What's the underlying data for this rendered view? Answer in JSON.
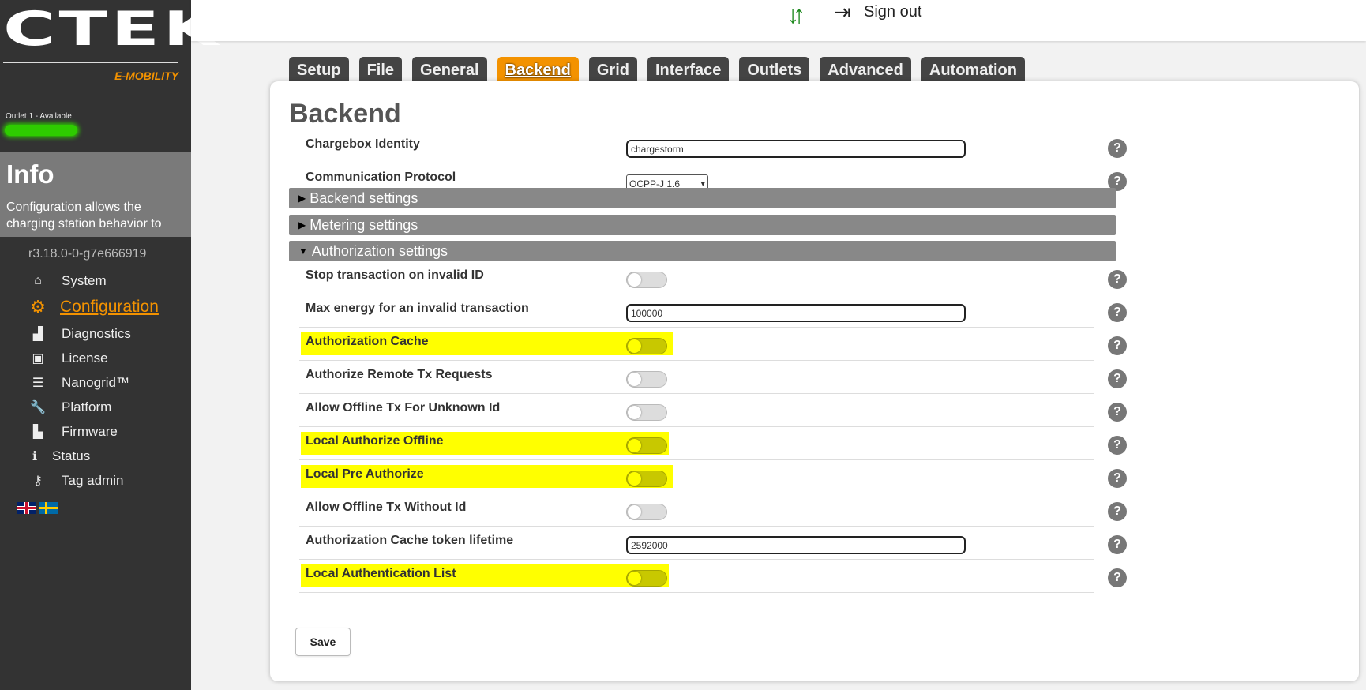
{
  "brand": {
    "logo": "CTEK",
    "sub": "E-MOBILITY"
  },
  "outlet": {
    "label": "Outlet 1 - Available",
    "led_color": "#2ecc00"
  },
  "info": {
    "title": "Info",
    "text": "Configuration allows the charging station behavior to"
  },
  "version": "r3.18.0-0-g7e666919",
  "nav": [
    {
      "label": "System",
      "icon": "home-icon",
      "glyph": "⌂"
    },
    {
      "label": "Configuration",
      "icon": "gear-icon",
      "glyph": "⚙",
      "active": true
    },
    {
      "label": "Diagnostics",
      "icon": "bar-chart-icon",
      "glyph": "▟"
    },
    {
      "label": "License",
      "icon": "license-icon",
      "glyph": "▣"
    },
    {
      "label": "Nanogrid™",
      "icon": "sliders-icon",
      "glyph": "☰"
    },
    {
      "label": "Platform",
      "icon": "wrench-icon",
      "glyph": "🔧"
    },
    {
      "label": "Firmware",
      "icon": "firmware-upload-icon",
      "glyph": "▙"
    },
    {
      "label": "Status",
      "icon": "info-icon",
      "glyph": "i"
    },
    {
      "label": "Tag admin",
      "icon": "key-icon",
      "glyph": "⚷"
    }
  ],
  "topbar": {
    "signout": "Sign out"
  },
  "tabs": [
    {
      "label": "Setup"
    },
    {
      "label": "File"
    },
    {
      "label": "General"
    },
    {
      "label": "Backend",
      "active": true
    },
    {
      "label": "Grid"
    },
    {
      "label": "Interface"
    },
    {
      "label": "Outlets"
    },
    {
      "label": "Advanced"
    },
    {
      "label": "Automation"
    }
  ],
  "page": {
    "title": "Backend",
    "rows_top": [
      {
        "label": "Chargebox Identity",
        "type": "text",
        "value": "chargestorm"
      },
      {
        "label": "Communication Protocol",
        "type": "select",
        "value": "OCPP-J 1.6"
      }
    ],
    "sections": [
      {
        "label": "Backend settings",
        "expanded": false
      },
      {
        "label": "Metering settings",
        "expanded": false
      },
      {
        "label": "Authorization settings",
        "expanded": true
      }
    ],
    "auth_rows": [
      {
        "label": "Stop transaction on invalid ID",
        "type": "toggle",
        "on": false,
        "highlight": false
      },
      {
        "label": "Max energy for an invalid transaction",
        "type": "text",
        "value": "100000",
        "highlight": false
      },
      {
        "label": "Authorization Cache",
        "type": "toggle",
        "on": false,
        "highlight": true
      },
      {
        "label": "Authorize Remote Tx Requests",
        "type": "toggle",
        "on": false,
        "highlight": false
      },
      {
        "label": "Allow Offline Tx For Unknown Id",
        "type": "toggle",
        "on": false,
        "highlight": false
      },
      {
        "label": "Local Authorize Offline",
        "type": "toggle",
        "on": false,
        "highlight": true
      },
      {
        "label": "Local Pre Authorize",
        "type": "toggle",
        "on": false,
        "highlight": true
      },
      {
        "label": "Allow Offline Tx Without Id",
        "type": "toggle",
        "on": false,
        "highlight": false
      },
      {
        "label": "Authorization Cache token lifetime",
        "type": "text",
        "value": "2592000",
        "highlight": false
      },
      {
        "label": "Local Authentication List",
        "type": "toggle",
        "on": false,
        "highlight": true
      }
    ],
    "help_glyph": "?",
    "save": "Save"
  },
  "colors": {
    "accent": "#f39200",
    "highlight": "#ffff00",
    "sidebar": "#333333",
    "sync": "#1e8a1e"
  }
}
